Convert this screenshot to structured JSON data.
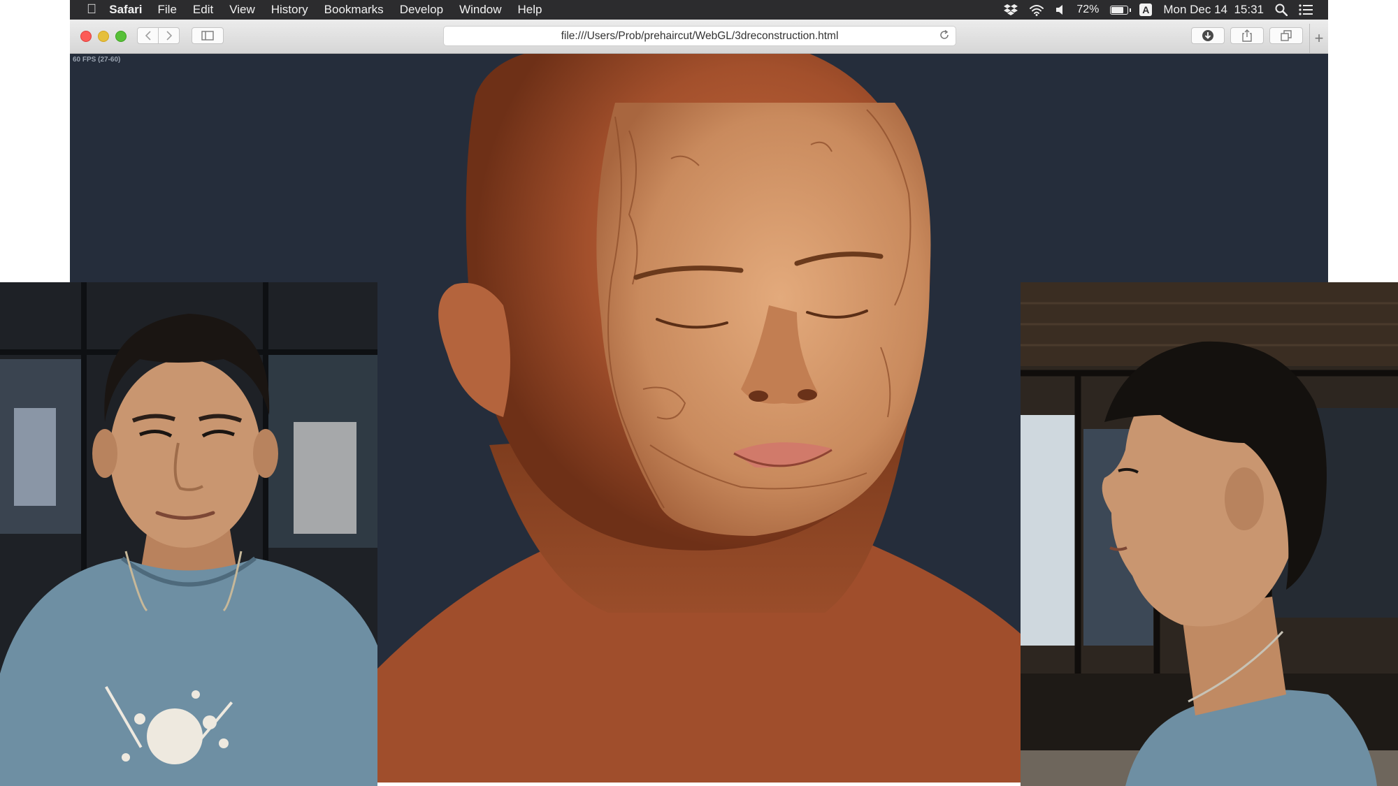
{
  "menubar": {
    "app_name": "Safari",
    "menus": [
      "File",
      "Edit",
      "View",
      "History",
      "Bookmarks",
      "Develop",
      "Window",
      "Help"
    ],
    "battery_percent": "72%",
    "input_source": "A",
    "clock": "Mon Dec 14  15:31",
    "status_icons": [
      "dropbox-icon",
      "wifi-icon",
      "volume-icon",
      "battery-icon",
      "input-source-icon",
      "spotlight-icon",
      "notification-center-icon"
    ]
  },
  "toolbar": {
    "url": "file:///Users/Prob/prehaircut/WebGL/3dreconstruction.html",
    "buttons": [
      "back-icon",
      "forward-icon",
      "sidebar-icon",
      "reload-icon",
      "download-icon",
      "share-icon",
      "tabs-overview-icon",
      "new-tab-icon"
    ]
  },
  "viewport": {
    "fps": "60 FPS (27-60)",
    "background_color": "#252d3b"
  },
  "render": {
    "skin_color": "#a8522f",
    "face_texture_color": "#d09468"
  }
}
